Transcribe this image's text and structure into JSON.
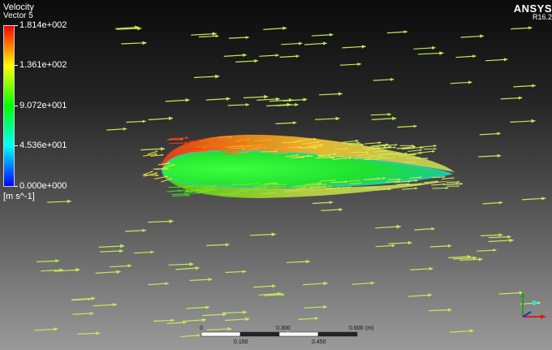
{
  "legend": {
    "title": "Velocity",
    "subtitle": "Vector 5",
    "labels": [
      "1.814e+002",
      "1.361e+002",
      "9.072e+001",
      "4.536e+001",
      "0.000e+000"
    ],
    "unit": "[m s^-1]",
    "colors": [
      "#ff0000",
      "#ffff00",
      "#00ff00",
      "#00ffff",
      "#0000ff"
    ]
  },
  "brand": {
    "name": "ANSYS",
    "version": "R16.2"
  },
  "scale_bar": {
    "top_labels": [
      "0",
      "0.300",
      "0.600",
      "(m)"
    ],
    "bottom_labels": [
      "0.150",
      "0.450"
    ]
  },
  "colors": {
    "freestream_arrow": "#c8e65a",
    "airfoil_body": "#22e63c"
  },
  "icons": {
    "axis_triad": "xyz-axis-triad-icon"
  }
}
